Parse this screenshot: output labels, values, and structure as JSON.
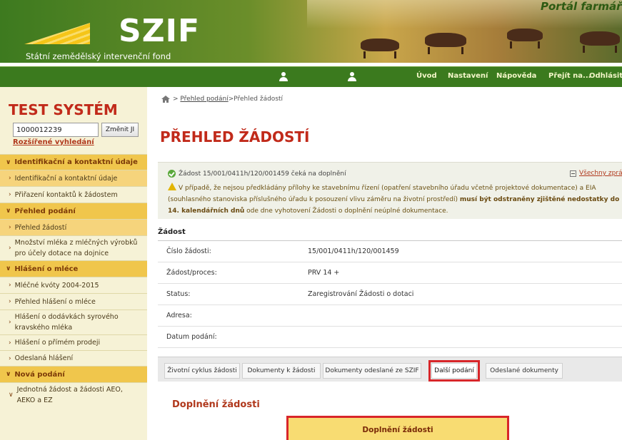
{
  "header": {
    "logo_text": "SZIF",
    "logo_subtitle": "Státní zemědělský intervenční fond",
    "portal_title": "Portál farmáře"
  },
  "topnav": {
    "links": [
      "Úvod",
      "Nastavení",
      "Nápověda",
      "Přejít na...",
      "Odhlásit"
    ]
  },
  "sidebar": {
    "system_title": "TEST SYSTÉM",
    "ji_value": "1000012239",
    "ji_button": "Změnit JI",
    "advanced_search": "Rozšířené vyhledání",
    "items": [
      {
        "label": "Identifikační a kontaktní údaje"
      },
      {
        "label": "Identifikační a kontaktní údaje"
      },
      {
        "label": "Přiřazení kontaktů k žádostem"
      },
      {
        "label": "Přehled podání"
      },
      {
        "label": "Přehled žádostí"
      },
      {
        "label": "Množství mléka z mléčných výrobků pro účely dotace na dojnice"
      },
      {
        "label": "Hlášení o mléce"
      },
      {
        "label": "Mléčné kvóty 2004-2015"
      },
      {
        "label": "Přehled hlášení o mléce"
      },
      {
        "label": "Hlášení o dodávkách syrového kravského mléka"
      },
      {
        "label": "Hlášení o přímém prodeji"
      },
      {
        "label": "Odeslaná hlášení"
      },
      {
        "label": "Nová podání"
      },
      {
        "label": "Jednotná žádost a žádosti AEO, AEKO a EZ"
      }
    ]
  },
  "breadcrumb": {
    "link": "Přehled podání",
    "separator": " > ",
    "current": "Přehled žádostí"
  },
  "main": {
    "page_title": "PŘEHLED ŽÁDOSTÍ",
    "status_message": "Žádost 15/001/0411h/120/001459 čeká na doplnění",
    "all_messages": "Všechny zprávy",
    "warning_part1": "V případě, že nejsou předkládány přílohy ke stavebnímu řízení (opatření stavebního úřadu včetně projektové dokumentace) a EIA (souhlasného stanoviska příslušného úřadu k posouzení vlivu záměru na životní prostředí) ",
    "warning_bold": "musí být odstraněny zjištěné nedostatky do 14. kalendářních dnů",
    "warning_part2": " ode dne vyhotovení Žádosti o doplnění neúplné dokumentace.",
    "section_title": "Žádost",
    "details": [
      {
        "label": "Číslo žádosti:",
        "value": "15/001/0411h/120/001459"
      },
      {
        "label": "Žádost/proces:",
        "value": "PRV 14 +"
      },
      {
        "label": "Status:",
        "value": "Zaregistrování Žádosti o dotaci"
      },
      {
        "label": "Adresa:",
        "value": ""
      },
      {
        "label": "Datum podání:",
        "value": ""
      }
    ],
    "tabs": [
      "Životní cyklus žádosti",
      "Dokumenty k žádosti",
      "Dokumenty odeslané ze SZIF",
      "Další podání",
      "Odeslané dokumenty"
    ],
    "selected_tab": "Další podání",
    "doplneni_title": "Doplnění žádosti",
    "doplneni_button": "Doplnění žádosti"
  },
  "colors": {
    "brand_green": "#3b7a1e",
    "accent_red": "#c12a1a",
    "highlight_red": "#d8262a",
    "menu_yellow": "#f0c64c"
  }
}
